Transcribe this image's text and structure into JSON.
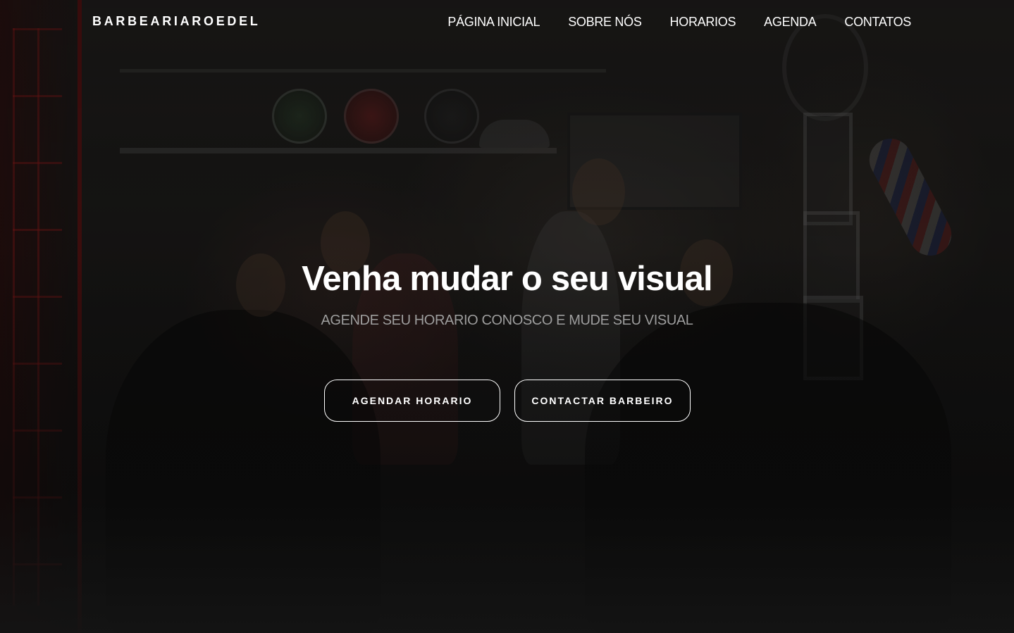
{
  "navbar": {
    "brand": "BARBEARIAROEDEL",
    "links": [
      {
        "label": "PÁGINA INICIAL"
      },
      {
        "label": "SOBRE NÓS"
      },
      {
        "label": "HORARIOS"
      },
      {
        "label": "AGENDA"
      },
      {
        "label": "CONTATOS"
      }
    ]
  },
  "hero": {
    "title": "Venha mudar o seu visual",
    "subtitle": "AGENDE SEU HORARIO CONOSCO E MUDE SEU VISUAL",
    "primary_button": "AGENDAR HORARIO",
    "secondary_button": "CONTACTAR BARBEIRO",
    "background_image": "barbershop-interior-photo"
  },
  "colors": {
    "text": "#ffffff",
    "subtitle": "#9d9d9d",
    "background": "#141414"
  }
}
